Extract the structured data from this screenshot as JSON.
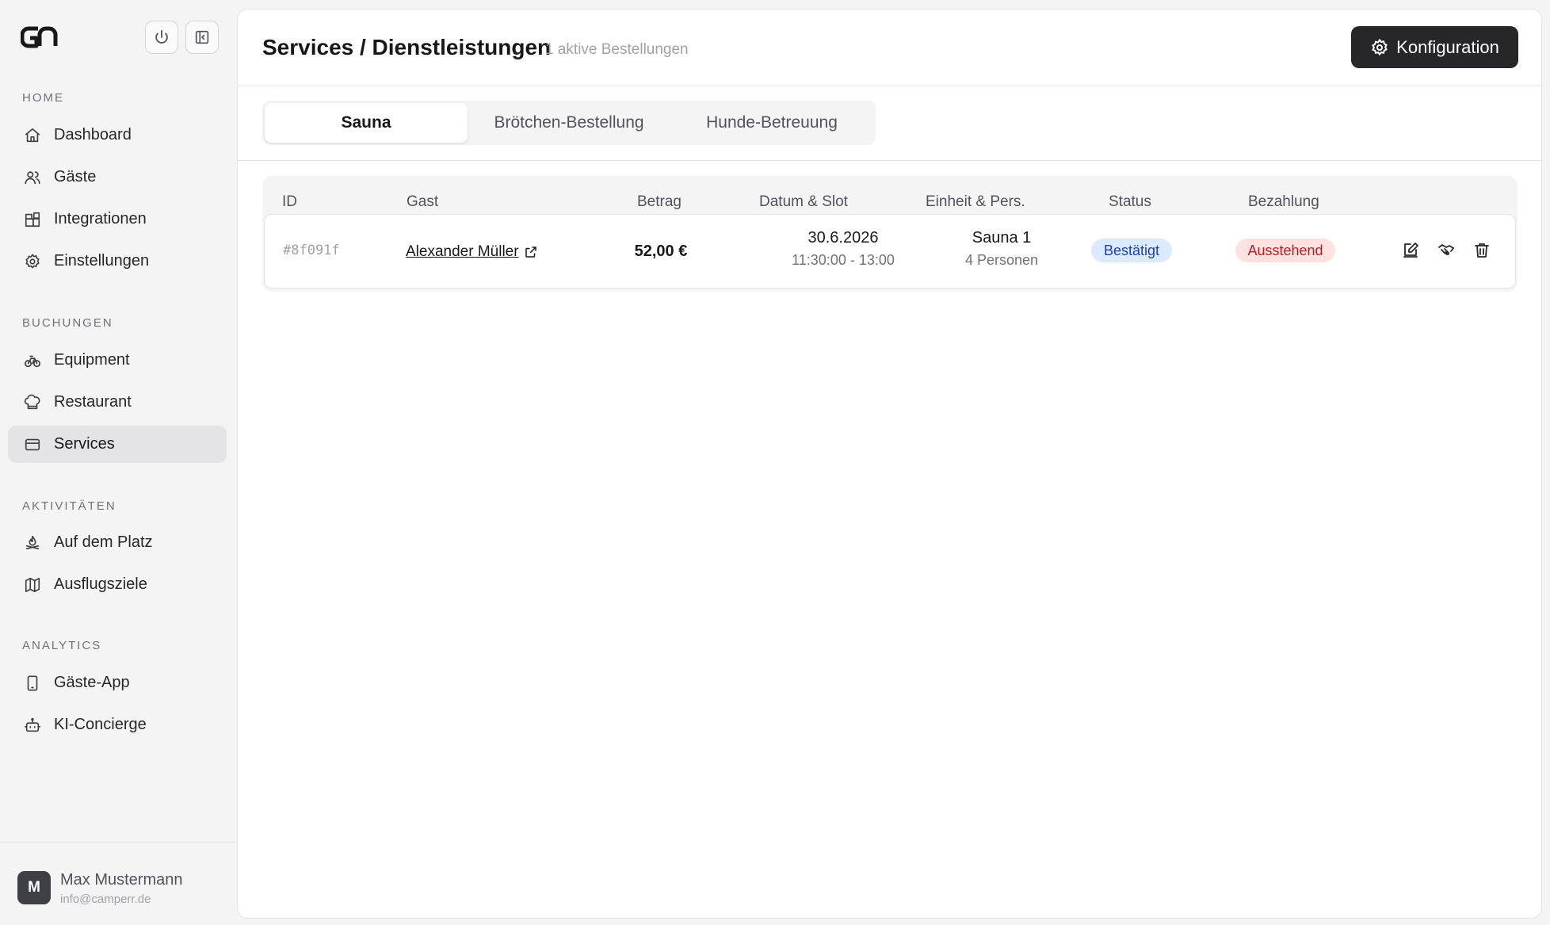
{
  "sidebar": {
    "sections": [
      {
        "label": "HOME"
      },
      {
        "label": "BUCHUNGEN"
      },
      {
        "label": "AKTIVITÄTEN"
      },
      {
        "label": "ANALYTICS"
      }
    ],
    "items": [
      {
        "label": "Dashboard",
        "icon": "home-icon"
      },
      {
        "label": "Gäste",
        "icon": "users-icon"
      },
      {
        "label": "Integrationen",
        "icon": "blocks-icon"
      },
      {
        "label": "Einstellungen",
        "icon": "gear-icon"
      },
      {
        "label": "Equipment",
        "icon": "bike-icon"
      },
      {
        "label": "Restaurant",
        "icon": "chef-hat-icon"
      },
      {
        "label": "Services",
        "icon": "card-icon",
        "active": true
      },
      {
        "label": "Auf dem Platz",
        "icon": "campfire-icon"
      },
      {
        "label": "Ausflugsziele",
        "icon": "map-icon"
      },
      {
        "label": "Gäste-App",
        "icon": "phone-icon"
      },
      {
        "label": "KI-Concierge",
        "icon": "bot-icon"
      }
    ],
    "user": {
      "initial": "M",
      "name": "Max Mustermann",
      "email": "info@camperr.de"
    }
  },
  "header": {
    "title": "Services / Dienstleistungen",
    "subtitle": "1 aktive Bestellungen",
    "config_label": "Konfiguration"
  },
  "tabs": [
    {
      "label": "Sauna",
      "active": true
    },
    {
      "label": "Brötchen-Bestellung"
    },
    {
      "label": "Hunde-Betreuung"
    }
  ],
  "table": {
    "columns": [
      "ID",
      "Gast",
      "Betrag",
      "Datum & Slot",
      "Einheit & Pers.",
      "Status",
      "Bezahlung"
    ],
    "rows": [
      {
        "id": "#8f091f",
        "guest": "Alexander Müller",
        "amount": "52,00 €",
        "date": "30.6.2026",
        "slot": "11:30:00 - 13:00",
        "unit": "Sauna 1",
        "persons": "4 Personen",
        "status": "Bestätigt",
        "payment": "Ausstehend"
      }
    ]
  },
  "colors": {
    "accent_dark": "#27272a",
    "status_blue": "#1e40af",
    "payment_red": "#b91c1c"
  }
}
